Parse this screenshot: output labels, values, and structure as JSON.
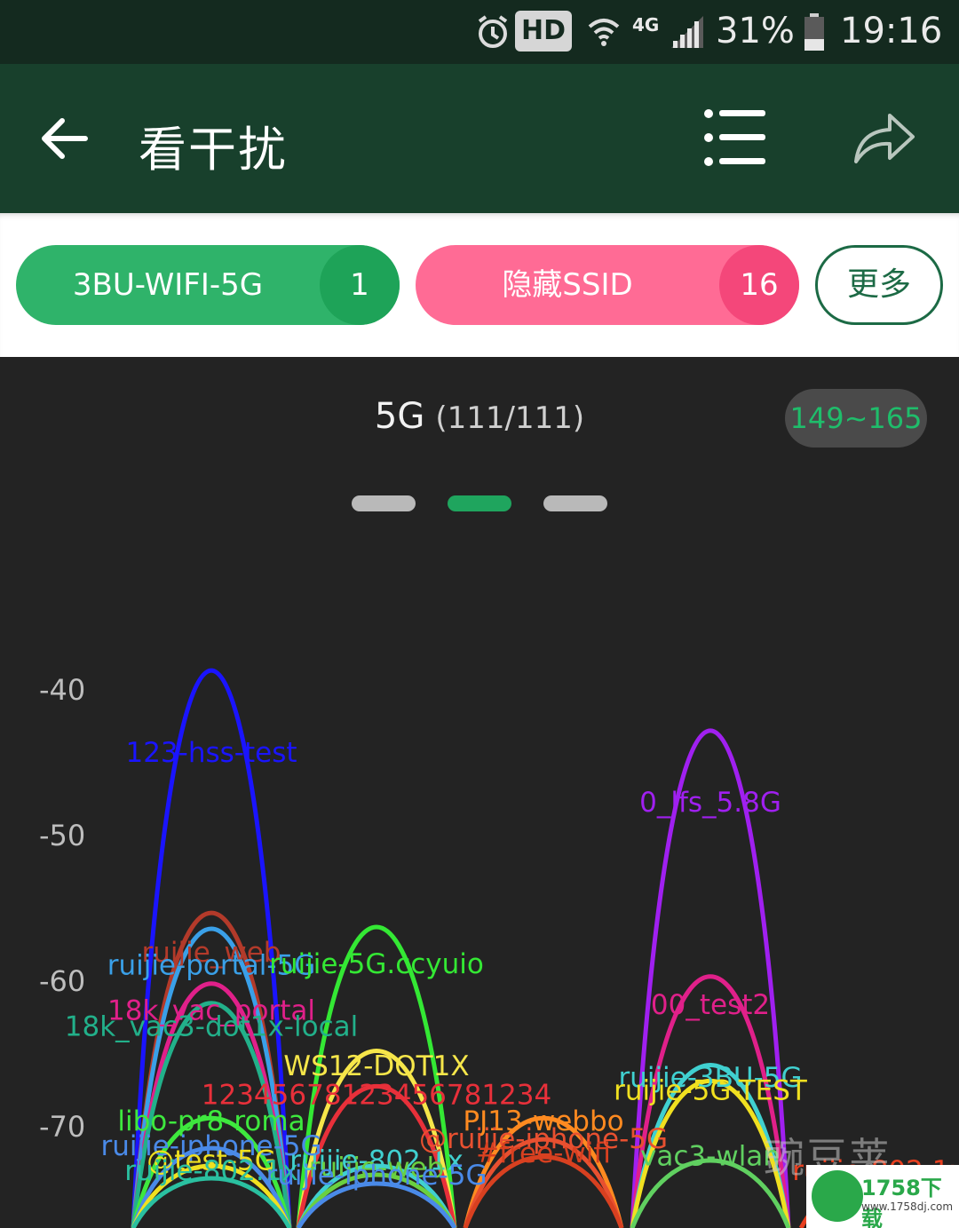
{
  "status_bar": {
    "hd_label": "HD",
    "network_label": "4G",
    "battery": "31%",
    "time": "19:16",
    "icons": [
      "alarm-icon",
      "wifi-icon",
      "signal-icon",
      "battery-icon"
    ]
  },
  "app_bar": {
    "title": "看干扰",
    "icons": [
      "back-arrow-icon",
      "list-menu-icon",
      "share-icon"
    ]
  },
  "filters": {
    "wifi_chip": {
      "label": "3BU-WIFI-5G",
      "count": "1",
      "color": "#2fb36a",
      "count_color": "#1ea358"
    },
    "hidden_chip": {
      "label": "隐藏SSID",
      "count": "16",
      "color": "#ff6b95",
      "count_color": "#f4477a"
    },
    "more_label": "更多"
  },
  "chart_panel": {
    "band": "5G",
    "count": "(111/111)",
    "channel_range": "149~165",
    "pages": 3,
    "active_page": 1,
    "accent": "#1fa55e"
  },
  "chart_data": {
    "type": "area",
    "ylim": [
      -40,
      -75
    ],
    "y_ticks": [
      "-40",
      "-50",
      "-60",
      "-70"
    ],
    "series": [
      {
        "name": "123-hss-test",
        "channel": 149,
        "level": -45.5,
        "color": "#1a14ff"
      },
      {
        "name": "ruijie_web",
        "channel": 149,
        "level": -59.2,
        "color": "#b33a2a"
      },
      {
        "name": "ruijie-portal-5G",
        "channel": 149,
        "level": -60.1,
        "color": "#3aa0e8"
      },
      {
        "name": "18k_vac_portal",
        "channel": 149,
        "level": -63.2,
        "color": "#e0208a"
      },
      {
        "name": "18k_vac3-dot1x-local",
        "channel": 149,
        "level": -64.3,
        "color": "#22b08a"
      },
      {
        "name": "libo-pr8-roma",
        "channel": 149,
        "level": -70.8,
        "color": "#3ee83e"
      },
      {
        "name": "ruijie-iphone-5G",
        "channel": 149,
        "level": -72.5,
        "color": "#4a8ae8"
      },
      {
        "name": "@test-5G",
        "channel": 149,
        "level": -73.5,
        "color": "#f0e020"
      },
      {
        "name": "ruijie-802.1x",
        "channel": 149,
        "level": -74.2,
        "color": "#2ac0a0"
      },
      {
        "name": "ruijie-5G.ccyuio",
        "channel": 153,
        "level": -60.0,
        "color": "#34e834"
      },
      {
        "name": "WS12-DOT1X",
        "channel": 153,
        "level": -67.0,
        "color": "#f6e64a"
      },
      {
        "name": "12345678123456781234",
        "channel": 153,
        "level": -69.0,
        "color": "#e8303a"
      },
      {
        "name": "ruijie-802.1x",
        "channel": 153,
        "level": -73.5,
        "color": "#40d0d0"
      },
      {
        "name": "ruijie-web",
        "channel": 153,
        "level": -74.0,
        "color": "#6ad040"
      },
      {
        "name": "ruijie-iphone-5G",
        "channel": 153,
        "level": -74.5,
        "color": "#4a8ae8"
      },
      {
        "name": "PJ13-webbo",
        "channel": 157,
        "level": -70.8,
        "color": "#ff8a20"
      },
      {
        "name": "@ruijie-iphone-5G",
        "channel": 157,
        "level": -72.0,
        "color": "#e85030"
      },
      {
        "name": "#free-wifi",
        "channel": 157,
        "level": -73.0,
        "color": "#d84020"
      },
      {
        "name": "0_lfs_5.8G",
        "channel": 161,
        "level": -48.9,
        "color": "#a020f0"
      },
      {
        "name": "00_test2",
        "channel": 161,
        "level": -62.8,
        "color": "#e0208a"
      },
      {
        "name": "ruijie-3BU-5G",
        "channel": 161,
        "level": -67.8,
        "color": "#40d0d0"
      },
      {
        "name": "ruijie-5G-TEST",
        "channel": 161,
        "level": -68.7,
        "color": "#f0e020"
      },
      {
        "name": "vac3-wlan",
        "channel": 161,
        "level": -73.2,
        "color": "#60d060"
      },
      {
        "name": "ruijie-802.1x",
        "channel": 165,
        "level": -74.2,
        "color": "#e84020"
      }
    ]
  }
}
